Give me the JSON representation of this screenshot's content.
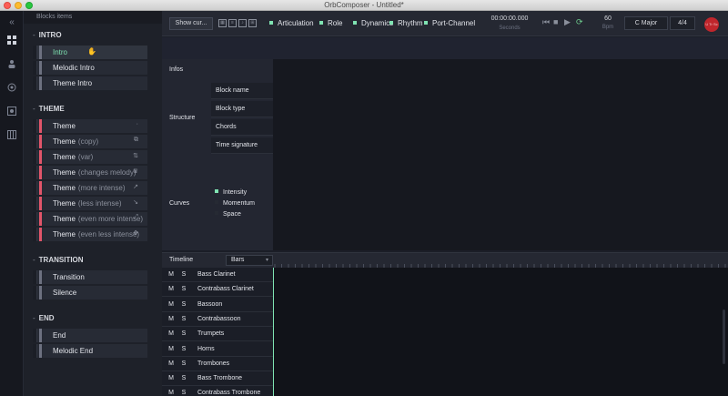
{
  "window": {
    "title": "OrbComposer - Untitled*"
  },
  "rail": {
    "collapse_icon": "double-chevron-left-icon",
    "items": [
      "blocks-icon",
      "person-icon",
      "target-icon",
      "gear-box-icon",
      "piano-icon"
    ]
  },
  "blocks_panel": {
    "title": "Blocks items",
    "sections": [
      {
        "name": "INTRO",
        "blocks": [
          {
            "label": "Intro",
            "sub": "",
            "color": "#6d7180",
            "icon": "hand-cursor-icon",
            "selected": true
          },
          {
            "label": "Melodic Intro",
            "sub": "",
            "color": "#6d7180",
            "icon": ""
          },
          {
            "label": "Theme Intro",
            "sub": "",
            "color": "#6d7180",
            "icon": ""
          }
        ]
      },
      {
        "name": "THEME",
        "blocks": [
          {
            "label": "Theme",
            "sub": "",
            "color": "#e2556a",
            "icon": "dot-icon"
          },
          {
            "label": "Theme",
            "sub": "(copy)",
            "color": "#e2556a",
            "icon": "copy-icon"
          },
          {
            "label": "Theme",
            "sub": "(var)",
            "color": "#e2556a",
            "icon": "swap-icon"
          },
          {
            "label": "Theme",
            "sub": "(changes melody)",
            "color": "#e2556a",
            "icon": "crown-icon"
          },
          {
            "label": "Theme",
            "sub": "(more intense)",
            "color": "#e2556a",
            "icon": "arrow-up-right-icon"
          },
          {
            "label": "Theme",
            "sub": "(less intense)",
            "color": "#e2556a",
            "icon": "arrow-down-right-icon"
          },
          {
            "label": "Theme",
            "sub": "(even more intense)",
            "color": "#e2556a",
            "icon": "expand-icon"
          },
          {
            "label": "Theme",
            "sub": "(even less intense)",
            "color": "#e2556a",
            "icon": "collapse-icon"
          }
        ]
      },
      {
        "name": "TRANSITION",
        "blocks": [
          {
            "label": "Transition",
            "sub": "",
            "color": "#6d7180",
            "icon": ""
          },
          {
            "label": "Silence",
            "sub": "",
            "color": "#6d7180",
            "icon": ""
          }
        ]
      },
      {
        "name": "END",
        "blocks": [
          {
            "label": "End",
            "sub": "",
            "color": "#6d7180",
            "icon": ""
          },
          {
            "label": "Melodic End",
            "sub": "",
            "color": "#6d7180",
            "icon": ""
          }
        ]
      }
    ]
  },
  "toolbar": {
    "show_button": "Show cur...",
    "view_icons": [
      "grid-view-icon",
      "list-view-icon",
      "score-view-icon",
      "mixer-view-icon"
    ],
    "filters": [
      "Articulation",
      "Role",
      "Dynamics",
      "Rhythm",
      "Port-Channel"
    ],
    "time": "00:00:00.000",
    "time_unit": "Seconds",
    "transport": [
      "skip-back-icon",
      "stop-icon",
      "play-icon",
      "loop-icon"
    ],
    "tempo": "60",
    "tempo_unit": "Bpm",
    "key": "C Major",
    "signature": "4/4",
    "avatar_text": "U Tr Sc Ct"
  },
  "infos": {
    "title": "Infos",
    "structure_label": "Structure",
    "fields": [
      "Block name",
      "Block type",
      "Chords",
      "Time signature"
    ],
    "curves_label": "Curves",
    "curves": [
      {
        "name": "Intensity",
        "color": "#7fe3b2"
      },
      {
        "name": "Momentum",
        "color": "#262a33"
      },
      {
        "name": "Space",
        "color": "#262a33"
      }
    ]
  },
  "timeline": {
    "label": "Timeline",
    "unit": "Bars",
    "tracks": [
      {
        "m": "M",
        "s": "S",
        "name": "Bass Clarinet"
      },
      {
        "m": "M",
        "s": "S",
        "name": "Contrabass Clarinet"
      },
      {
        "m": "M",
        "s": "S",
        "name": "Bassoon"
      },
      {
        "m": "M",
        "s": "S",
        "name": "Contrabassoon"
      },
      {
        "m": "M",
        "s": "S",
        "name": "Trumpets"
      },
      {
        "m": "M",
        "s": "S",
        "name": "Horns"
      },
      {
        "m": "M",
        "s": "S",
        "name": "Trombones"
      },
      {
        "m": "M",
        "s": "S",
        "name": "Bass Trombone"
      },
      {
        "m": "M",
        "s": "S",
        "name": "Contrabass Trombone"
      }
    ]
  }
}
